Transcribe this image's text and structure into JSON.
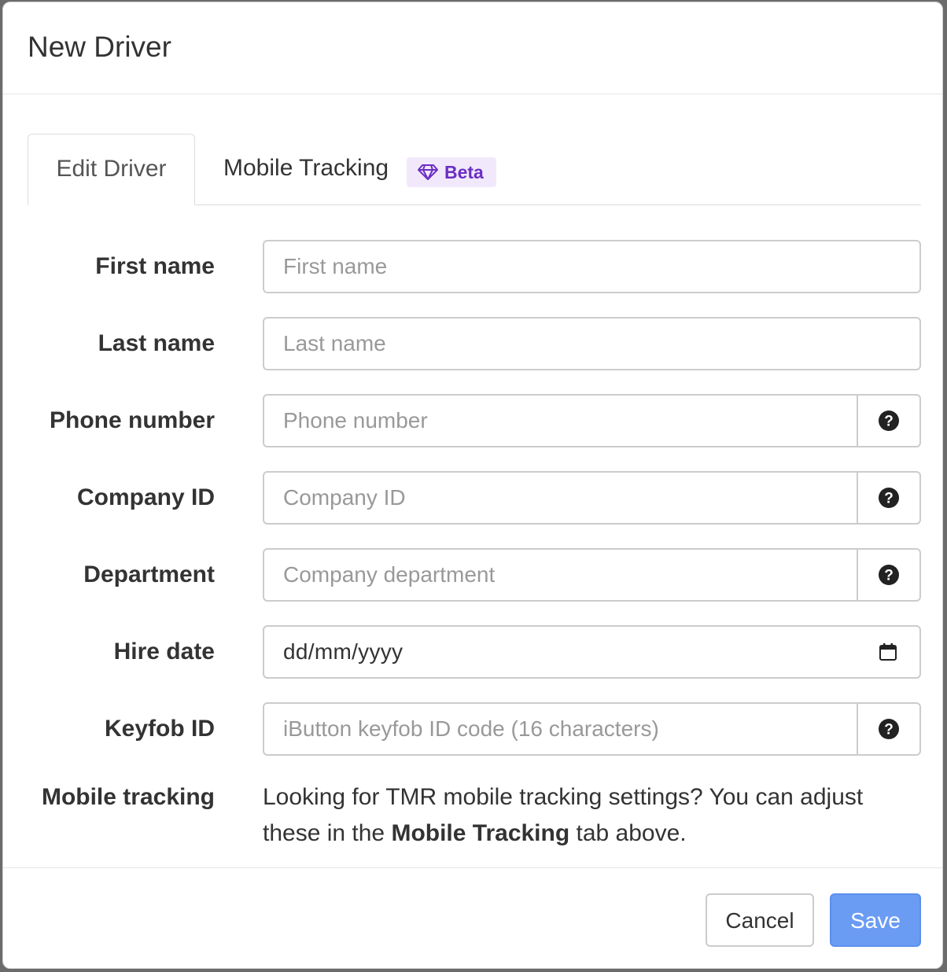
{
  "dialog": {
    "title": "New Driver"
  },
  "tabs": [
    {
      "label": "Edit Driver",
      "active": true
    },
    {
      "label": "Mobile Tracking",
      "active": false,
      "badge": "Beta",
      "badge_icon": "diamond-icon"
    }
  ],
  "form": {
    "first_name": {
      "label": "First name",
      "placeholder": "First name",
      "value": ""
    },
    "last_name": {
      "label": "Last name",
      "placeholder": "Last name",
      "value": ""
    },
    "phone_number": {
      "label": "Phone number",
      "placeholder": "Phone number",
      "value": "",
      "help_icon": "question-circle-icon"
    },
    "company_id": {
      "label": "Company ID",
      "placeholder": "Company ID",
      "value": "",
      "help_icon": "question-circle-icon"
    },
    "department": {
      "label": "Department",
      "placeholder": "Company department",
      "value": "",
      "help_icon": "question-circle-icon"
    },
    "hire_date": {
      "label": "Hire date",
      "placeholder": "dd/mm/yyyy",
      "icon": "calendar-icon"
    },
    "keyfob_id": {
      "label": "Keyfob ID",
      "placeholder": "iButton keyfob ID code (16 characters)",
      "value": "",
      "help_icon": "question-circle-icon"
    },
    "mobile_tracking": {
      "label": "Mobile tracking",
      "text_before": "Looking for TMR mobile tracking settings? You can adjust these in the ",
      "text_bold": "Mobile Tracking",
      "text_after": " tab above."
    }
  },
  "footer": {
    "cancel_label": "Cancel",
    "save_label": "Save"
  },
  "colors": {
    "primary": "#6b9cf4",
    "beta_bg": "#f1e9fb",
    "beta_text": "#6b2fc4"
  }
}
